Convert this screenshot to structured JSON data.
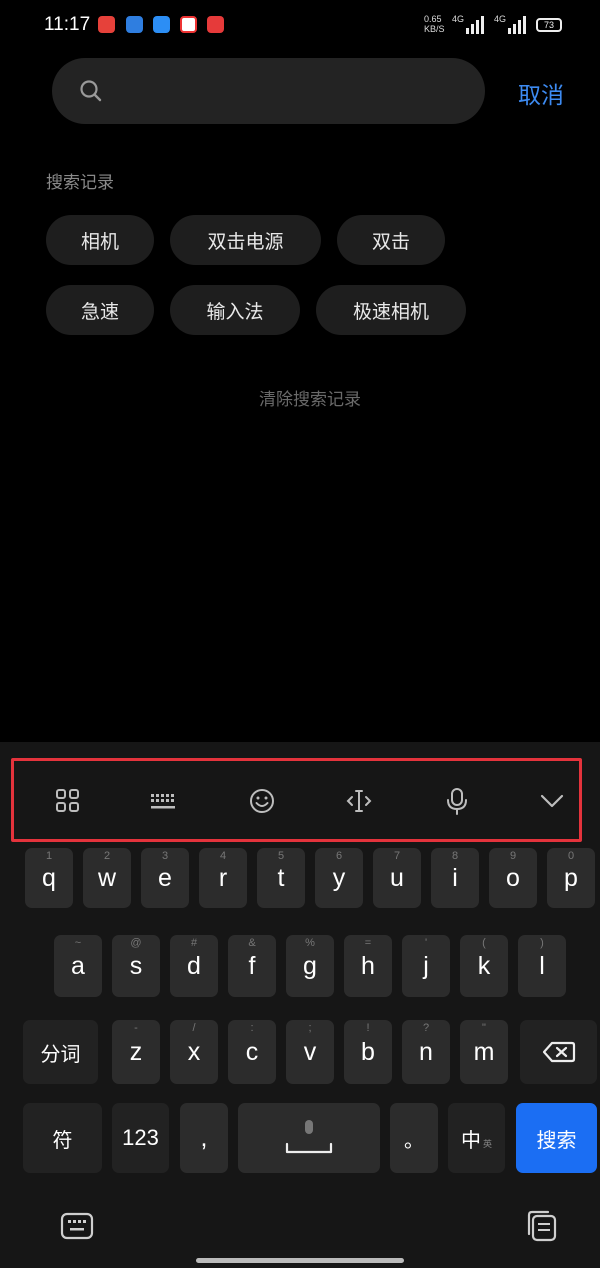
{
  "status_bar": {
    "time": "11:17",
    "network_speed_top": "0.65",
    "network_speed_bottom": "KB/S",
    "sim1": "4G",
    "sim2": "4G",
    "battery": "73"
  },
  "search": {
    "placeholder": "",
    "value": "",
    "cancel_label": "取消"
  },
  "history": {
    "title": "搜索记录",
    "chips": [
      "相机",
      "双击电源",
      "双击",
      "急速",
      "输入法",
      "极速相机"
    ],
    "clear_label": "清除搜索记录"
  },
  "keyboard": {
    "toolbar_icons": [
      "grid-icon",
      "keyboard-icon",
      "emoji-icon",
      "cursor-icon",
      "microphone-icon",
      "chevron-down-icon"
    ],
    "row1": [
      "q",
      "w",
      "e",
      "r",
      "t",
      "y",
      "u",
      "i",
      "o",
      "p"
    ],
    "row1_hints": [
      "1",
      "2",
      "3",
      "4",
      "5",
      "6",
      "7",
      "8",
      "9",
      "0"
    ],
    "row2": [
      "a",
      "s",
      "d",
      "f",
      "g",
      "h",
      "j",
      "k",
      "l"
    ],
    "row2_hints": [
      "~",
      "@",
      "#",
      "&",
      "%",
      "=",
      "'",
      "(",
      ")"
    ],
    "row3": [
      "z",
      "x",
      "c",
      "v",
      "b",
      "n",
      "m"
    ],
    "row3_hints": [
      "-",
      "/",
      ":",
      ";",
      "!",
      "?",
      "\""
    ],
    "segment_label": "分词",
    "symbol_label": "符",
    "number_label": "123",
    "comma_label": ",",
    "period_label": "。",
    "language_label": "中",
    "language_sub": "英",
    "search_label": "搜索"
  },
  "colors": {
    "accent": "#3d8bf2",
    "search_key": "#1b6ef3",
    "highlight_box": "#e4333c"
  }
}
